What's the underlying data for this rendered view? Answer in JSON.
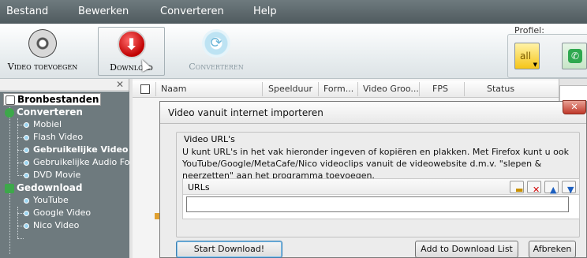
{
  "menu": [
    "Bestand",
    "Bewerken",
    "Converteren",
    "Help"
  ],
  "toolbar": {
    "add_video": "Video toevoegen",
    "download": "Download",
    "convert": "Converteren",
    "profiel_label": "Profiel:",
    "profile_all": "all"
  },
  "tree": {
    "root": "Bronbestanden",
    "converteren": "Converteren",
    "convert_items": [
      "Mobiel",
      "Flash Video",
      "Gebruikelijke Video F",
      "Gebruikelijke Audio Form",
      "DVD Movie"
    ],
    "gedownload": "Gedownload",
    "download_items": [
      "YouTube",
      "Google Video",
      "Nico Video"
    ]
  },
  "grid": {
    "columns": [
      "Naam",
      "Speelduur",
      "Form...",
      "Video Groo...",
      "FPS",
      "Status"
    ]
  },
  "dialog": {
    "title": "Video vanuit internet importeren",
    "group_label": "Video URL's",
    "description": "U kunt URL's in het vak hieronder ingeven of kopiëren en plakken. Met Firefox kunt u ook YouTube/Google/MetaCafe/Nico videoclips vanuit de videowebsite d.m.v. \"slepen & neerzetten\" aan het programma toevoegen.",
    "urls_label": "URLs",
    "url_value": "",
    "start_button": "Start Download!",
    "add_list_button": "Add to Download List",
    "cancel_button": "Afbreken"
  },
  "colors": {
    "menubar": "#5c676b",
    "tree_bg": "#6e7a7e",
    "download_red": "#c00000",
    "profile_yellow": "#f5c518",
    "profile_green": "#2fa84f"
  }
}
